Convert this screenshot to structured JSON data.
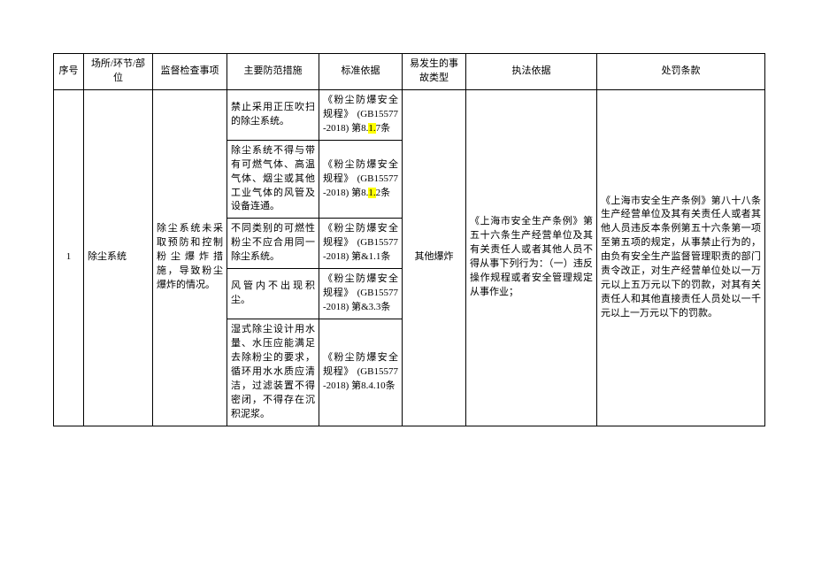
{
  "headers": {
    "c0": "序号",
    "c1": "场所/环节/部位",
    "c2": "监督检查事项",
    "c3": "主要防范措施",
    "c4": "标准依据",
    "c5": "易发生的事故类型",
    "c6": "执法依据",
    "c7": "处罚条款"
  },
  "row": {
    "seq": "1",
    "place": "除尘系统",
    "inspect": "除尘系统未采取预防和控制粉尘爆炸措施，导致粉尘爆炸的情况。",
    "accident": "其他爆炸",
    "basisLaw": "《上海市安全生产条例》第五十六条生产经营单位及其有关责任人或者其他人员不得从事下列行为：（一）违反操作规程或者安全管理规定从事作业；",
    "penalty": "《上海市安全生产条例》第八十八条生产经营单位及其有关责任人或者其他人员违反本条例第五十六条第一项至第五项的规定，从事禁止行为的，由负有安全生产监督管理职责的部门责令改正，对生产经营单位处以一万元以上五万元以下的罚款，对其有关责任人和其他直接责任人员处以一千元以上一万元以下的罚款。",
    "measures": [
      {
        "m": "禁止采用正压吹扫的除尘系统。",
        "s_title": "《粉尘防爆安全规程》",
        "s_code": "(GB15577-2018)",
        "s_art_pre": "第8.",
        "s_art_hl": "1.",
        "s_art_post": "7条"
      },
      {
        "m": "除尘系统不得与带有可燃气体、高温气体、烟尘或其他工业气体的风管及设备连通。",
        "s_title": "《粉尘防爆安全规程》",
        "s_code": "(GB15577-2018)",
        "s_art_pre": "第8.",
        "s_art_hl": "1.",
        "s_art_post": "2条"
      },
      {
        "m": "不同类别的可燃性粉尘不应合用同一除尘系统。",
        "s_title": "《粉尘防爆安全规程》",
        "s_code": "(GB15577-2018)",
        "s_art_pre": "第&1.1条",
        "s_art_hl": "",
        "s_art_post": ""
      },
      {
        "m": "风管内不出现积尘。",
        "s_title": "《粉尘防爆安全规程》",
        "s_code": "(GB15577-2018)",
        "s_art_pre": "第&3.3条",
        "s_art_hl": "",
        "s_art_post": ""
      },
      {
        "m": "湿式除尘设计用水量、水压应能满足去除粉尘的要求，循环用水水质应清洁，过滤装置不得密闭，不得存在沉积泥浆。",
        "s_title": "《粉尘防爆安全规程》",
        "s_code": "(GB15577-2018)",
        "s_art_pre": "第8.4.10条",
        "s_art_hl": "",
        "s_art_post": ""
      }
    ]
  }
}
